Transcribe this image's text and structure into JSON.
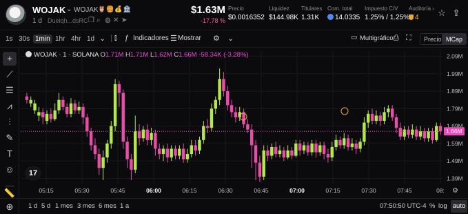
{
  "token": {
    "name": "WOJAK",
    "symbol": "WOJAK",
    "badges": "🦉🍔💰🏦",
    "age": "1 d",
    "address": "Dueiqh...dsRC"
  },
  "price": {
    "value": "$1.63M",
    "change": "-17.78 %"
  },
  "stats": [
    {
      "label": "Precio",
      "value": "$0.0016352"
    },
    {
      "label": "Liquidez",
      "value": "$144.98K"
    },
    {
      "label": "Titulares",
      "value": "1.31K"
    },
    {
      "label": "Com. total",
      "value": "14.0335"
    },
    {
      "label": "Impuesto C/V",
      "value": "1.25% / 1.25%"
    },
    {
      "label": "Auditoría ›",
      "value": "4"
    }
  ],
  "toolbar": {
    "timeframes": [
      "1s",
      "30s",
      "1min",
      "1hr",
      "4hr",
      "1d"
    ],
    "active_timeframe": "1min",
    "indicators_label": "Indicadores",
    "show_label": "Mostrar",
    "multichart_label": "Multigráfico",
    "mode_options": [
      "Precio",
      "MCap"
    ],
    "active_mode": "MCap"
  },
  "legend": {
    "title": "WOJAK · 1 · SOLANA",
    "o_key": "O",
    "o_val": "1.71M",
    "h_key": "H",
    "h_val": "1.71M",
    "l_key": "L",
    "l_val": "1.62M",
    "c_key": "C",
    "c_val": "1.66M",
    "change": "-58.34K (-3.28%)"
  },
  "chart_data": {
    "type": "candlestick",
    "yticks": [
      "2.09M",
      "1.99M",
      "1.89M",
      "1.79M",
      "1.69M",
      "1.59M",
      "1.49M",
      "1.39M"
    ],
    "ytick_values": [
      2.09,
      1.99,
      1.89,
      1.79,
      1.69,
      1.59,
      1.49,
      1.39
    ],
    "ylim": [
      1.36,
      2.12
    ],
    "current_label": "1.66M",
    "current_value": 1.66,
    "xticks": [
      "05:15",
      "05:30",
      "05:45",
      "06:00",
      "06:15",
      "06:30",
      "06:45",
      "07:00",
      "07:15",
      "07:30",
      "07:45",
      "08:"
    ],
    "candles": [
      [
        1.86,
        1.84,
        1.88,
        1.82
      ],
      [
        1.82,
        1.84,
        1.86,
        1.8
      ],
      [
        1.78,
        1.82,
        1.84,
        1.76
      ],
      [
        1.75,
        1.77,
        1.8,
        1.72
      ],
      [
        1.77,
        1.74,
        1.79,
        1.7
      ],
      [
        1.72,
        1.76,
        1.78,
        1.7
      ],
      [
        1.76,
        1.73,
        1.79,
        1.71
      ],
      [
        1.73,
        1.78,
        1.82,
        1.72
      ],
      [
        1.78,
        1.84,
        1.88,
        1.76
      ],
      [
        1.84,
        1.8,
        1.86,
        1.78
      ],
      [
        1.8,
        1.76,
        1.82,
        1.74
      ],
      [
        1.76,
        1.82,
        1.85,
        1.74
      ],
      [
        1.82,
        1.78,
        1.84,
        1.76
      ],
      [
        1.78,
        1.8,
        1.83,
        1.76
      ],
      [
        1.8,
        1.74,
        1.82,
        1.7
      ],
      [
        1.74,
        1.66,
        1.76,
        1.63
      ],
      [
        1.66,
        1.58,
        1.68,
        1.55
      ],
      [
        1.58,
        1.53,
        1.62,
        1.5
      ],
      [
        1.53,
        1.45,
        1.56,
        1.41
      ],
      [
        1.45,
        1.51,
        1.55,
        1.38
      ],
      [
        1.51,
        1.59,
        1.61,
        1.48
      ],
      [
        1.59,
        1.69,
        1.72,
        1.56
      ],
      [
        1.69,
        1.93,
        1.96,
        1.66
      ],
      [
        1.93,
        1.88,
        1.95,
        1.8
      ],
      [
        1.88,
        1.6,
        1.9,
        1.56
      ],
      [
        1.6,
        1.5,
        1.63,
        1.45
      ],
      [
        1.5,
        1.44,
        1.53,
        1.38
      ],
      [
        1.44,
        1.66,
        1.75,
        1.42
      ],
      [
        1.66,
        1.62,
        1.7,
        1.58
      ],
      [
        1.62,
        1.67,
        1.69,
        1.6
      ],
      [
        1.67,
        1.61,
        1.7,
        1.58
      ],
      [
        1.61,
        1.65,
        1.68,
        1.58
      ],
      [
        1.65,
        1.56,
        1.67,
        1.52
      ],
      [
        1.56,
        1.53,
        1.59,
        1.5
      ],
      [
        1.53,
        1.56,
        1.58,
        1.49
      ],
      [
        1.56,
        1.51,
        1.59,
        1.48
      ],
      [
        1.51,
        1.56,
        1.58,
        1.49
      ],
      [
        1.56,
        1.52,
        1.58,
        1.5
      ],
      [
        1.52,
        1.56,
        1.58,
        1.5
      ],
      [
        1.56,
        1.5,
        1.59,
        1.48
      ],
      [
        1.5,
        1.53,
        1.56,
        1.48
      ],
      [
        1.53,
        1.58,
        1.61,
        1.51
      ],
      [
        1.58,
        1.55,
        1.61,
        1.52
      ],
      [
        1.55,
        1.61,
        1.63,
        1.53
      ],
      [
        1.61,
        1.69,
        1.72,
        1.59
      ],
      [
        1.69,
        1.68,
        1.73,
        1.65
      ],
      [
        1.68,
        1.79,
        1.82,
        1.66
      ],
      [
        1.79,
        1.84,
        1.86,
        1.76
      ],
      [
        1.84,
        1.96,
        2.02,
        1.81
      ],
      [
        1.96,
        1.89,
        2.0,
        1.86
      ],
      [
        1.89,
        1.81,
        1.92,
        1.78
      ],
      [
        1.81,
        1.77,
        1.84,
        1.74
      ],
      [
        1.77,
        1.74,
        1.8,
        1.71
      ],
      [
        1.74,
        1.77,
        1.8,
        1.72
      ],
      [
        1.77,
        1.7,
        1.79,
        1.68
      ],
      [
        1.7,
        1.67,
        1.73,
        1.65
      ],
      [
        1.67,
        1.58,
        1.7,
        1.45
      ],
      [
        1.58,
        1.48,
        1.61,
        1.38
      ],
      [
        1.48,
        1.4,
        1.52,
        1.37
      ],
      [
        1.4,
        1.55,
        1.58,
        1.38
      ],
      [
        1.55,
        1.52,
        1.58,
        1.49
      ],
      [
        1.52,
        1.57,
        1.59,
        1.5
      ],
      [
        1.57,
        1.53,
        1.6,
        1.51
      ],
      [
        1.53,
        1.55,
        1.58,
        1.51
      ],
      [
        1.55,
        1.51,
        1.57,
        1.49
      ],
      [
        1.51,
        1.55,
        1.58,
        1.5
      ],
      [
        1.55,
        1.52,
        1.57,
        1.5
      ],
      [
        1.52,
        1.59,
        1.61,
        1.51
      ],
      [
        1.59,
        1.55,
        1.61,
        1.52
      ],
      [
        1.55,
        1.58,
        1.6,
        1.53
      ],
      [
        1.58,
        1.54,
        1.6,
        1.52
      ],
      [
        1.54,
        1.59,
        1.61,
        1.52
      ],
      [
        1.59,
        1.54,
        1.61,
        1.51
      ],
      [
        1.54,
        1.58,
        1.6,
        1.52
      ],
      [
        1.58,
        1.53,
        1.6,
        1.5
      ],
      [
        1.53,
        1.51,
        1.56,
        1.48
      ],
      [
        1.51,
        1.57,
        1.6,
        1.49
      ],
      [
        1.57,
        1.61,
        1.64,
        1.55
      ],
      [
        1.61,
        1.58,
        1.63,
        1.56
      ],
      [
        1.58,
        1.62,
        1.65,
        1.56
      ],
      [
        1.62,
        1.57,
        1.64,
        1.55
      ],
      [
        1.57,
        1.59,
        1.62,
        1.55
      ],
      [
        1.59,
        1.56,
        1.61,
        1.53
      ],
      [
        1.56,
        1.6,
        1.62,
        1.54
      ],
      [
        1.6,
        1.71,
        1.74,
        1.58
      ],
      [
        1.71,
        1.76,
        1.78,
        1.68
      ],
      [
        1.76,
        1.72,
        1.79,
        1.7
      ],
      [
        1.72,
        1.75,
        1.78,
        1.7
      ],
      [
        1.75,
        1.72,
        1.77,
        1.69
      ],
      [
        1.72,
        1.77,
        1.8,
        1.7
      ],
      [
        1.77,
        1.79,
        1.81,
        1.74
      ],
      [
        1.79,
        1.74,
        1.81,
        1.72
      ],
      [
        1.74,
        1.68,
        1.76,
        1.65
      ],
      [
        1.68,
        1.63,
        1.71,
        1.61
      ],
      [
        1.63,
        1.67,
        1.69,
        1.61
      ],
      [
        1.67,
        1.64,
        1.69,
        1.62
      ],
      [
        1.64,
        1.67,
        1.7,
        1.62
      ],
      [
        1.67,
        1.63,
        1.69,
        1.61
      ],
      [
        1.63,
        1.66,
        1.69,
        1.61
      ],
      [
        1.66,
        1.62,
        1.68,
        1.6
      ],
      [
        1.62,
        1.66,
        1.68,
        1.6
      ],
      [
        1.66,
        1.61,
        1.68,
        1.59
      ],
      [
        1.61,
        1.69,
        1.71,
        1.6
      ],
      [
        1.69,
        1.66,
        1.71,
        1.64
      ]
    ],
    "colors": {
      "up": "#b5e94b",
      "down": "#ea4ca9",
      "grid": "#18181c",
      "current_line": "#e94bb8",
      "label_bg": "#e94bb8"
    }
  },
  "bottom": {
    "ranges": [
      "1 d",
      "5 d",
      "1 mes",
      "3 mes",
      "6 mes",
      "1 a"
    ],
    "time": "07:50:50 UTC-4",
    "percent": "%",
    "log": "log",
    "auto": "auto"
  }
}
